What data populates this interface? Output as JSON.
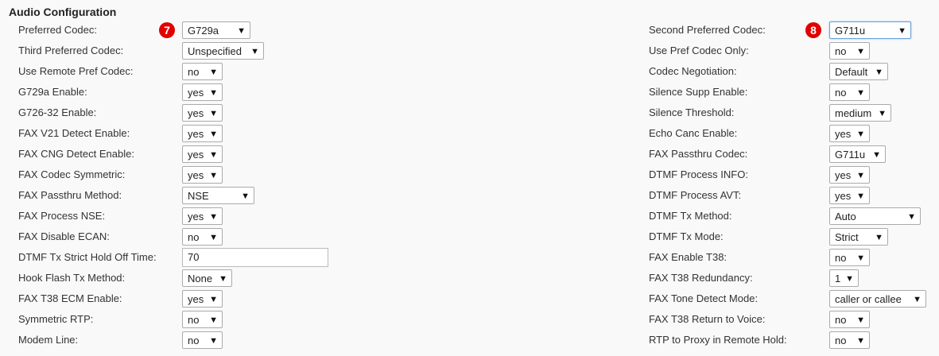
{
  "section_title": "Audio Configuration",
  "left": [
    {
      "label": "Preferred Codec:",
      "value": "G729a",
      "type": "select"
    },
    {
      "label": "Third Preferred Codec:",
      "value": "Unspecified",
      "type": "select"
    },
    {
      "label": "Use Remote Pref Codec:",
      "value": "no",
      "type": "select"
    },
    {
      "label": "G729a Enable:",
      "value": "yes",
      "type": "select"
    },
    {
      "label": "G726-32 Enable:",
      "value": "yes",
      "type": "select"
    },
    {
      "label": "FAX V21 Detect Enable:",
      "value": "yes",
      "type": "select"
    },
    {
      "label": "FAX CNG Detect Enable:",
      "value": "yes",
      "type": "select"
    },
    {
      "label": "FAX Codec Symmetric:",
      "value": "yes",
      "type": "select"
    },
    {
      "label": "FAX Passthru Method:",
      "value": "NSE",
      "type": "select"
    },
    {
      "label": "FAX Process NSE:",
      "value": "yes",
      "type": "select"
    },
    {
      "label": "FAX Disable ECAN:",
      "value": "no",
      "type": "select"
    },
    {
      "label": "DTMF Tx Strict Hold Off Time:",
      "value": "70",
      "type": "text"
    },
    {
      "label": "Hook Flash Tx Method:",
      "value": "None",
      "type": "select"
    },
    {
      "label": "FAX T38 ECM Enable:",
      "value": "yes",
      "type": "select"
    },
    {
      "label": "Symmetric RTP:",
      "value": "no",
      "type": "select"
    },
    {
      "label": "Modem Line:",
      "value": "no",
      "type": "select"
    }
  ],
  "right": [
    {
      "label": "Second Preferred Codec:",
      "value": "G711u",
      "type": "select"
    },
    {
      "label": "Use Pref Codec Only:",
      "value": "no",
      "type": "select"
    },
    {
      "label": "Codec Negotiation:",
      "value": "Default",
      "type": "select"
    },
    {
      "label": "Silence Supp Enable:",
      "value": "no",
      "type": "select"
    },
    {
      "label": "Silence Threshold:",
      "value": "medium",
      "type": "select"
    },
    {
      "label": "Echo Canc Enable:",
      "value": "yes",
      "type": "select"
    },
    {
      "label": "FAX Passthru Codec:",
      "value": "G711u",
      "type": "select"
    },
    {
      "label": "DTMF Process INFO:",
      "value": "yes",
      "type": "select"
    },
    {
      "label": "DTMF Process AVT:",
      "value": "yes",
      "type": "select"
    },
    {
      "label": "DTMF Tx Method:",
      "value": "Auto",
      "type": "select"
    },
    {
      "label": "DTMF Tx Mode:",
      "value": "Strict",
      "type": "select"
    },
    {
      "label": "FAX Enable T38:",
      "value": "no",
      "type": "select"
    },
    {
      "label": "FAX T38 Redundancy:",
      "value": "1",
      "type": "select"
    },
    {
      "label": "FAX Tone Detect Mode:",
      "value": "caller or callee",
      "type": "select"
    },
    {
      "label": "FAX T38 Return to Voice:",
      "value": "no",
      "type": "select"
    },
    {
      "label": "RTP to Proxy in Remote Hold:",
      "value": "no",
      "type": "select"
    }
  ],
  "badges": {
    "left": "7",
    "right": "8"
  },
  "colors": {
    "badge": "#e00000",
    "background": "#f9f9f9"
  },
  "dropdown_arrow": "▼"
}
